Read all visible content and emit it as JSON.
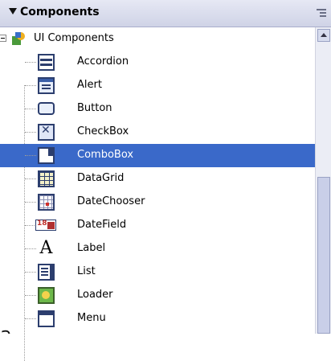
{
  "panel": {
    "title": "Components",
    "root_label": "UI Components",
    "items": [
      {
        "label": "Accordion",
        "icon": "accordion-icon"
      },
      {
        "label": "Alert",
        "icon": "alert-icon"
      },
      {
        "label": "Button",
        "icon": "button-icon"
      },
      {
        "label": "CheckBox",
        "icon": "checkbox-icon"
      },
      {
        "label": "ComboBox",
        "icon": "combobox-icon",
        "selected": true
      },
      {
        "label": "DataGrid",
        "icon": "datagrid-icon"
      },
      {
        "label": "DateChooser",
        "icon": "datechooser-icon"
      },
      {
        "label": "DateField",
        "icon": "datefield-icon"
      },
      {
        "label": "Label",
        "icon": "label-icon"
      },
      {
        "label": "List",
        "icon": "list-icon"
      },
      {
        "label": "Loader",
        "icon": "loader-icon"
      },
      {
        "label": "Menu",
        "icon": "menu-icon"
      }
    ]
  },
  "caption": "a",
  "colors": {
    "selection": "#3a69c9",
    "header": "#d8dbec"
  }
}
